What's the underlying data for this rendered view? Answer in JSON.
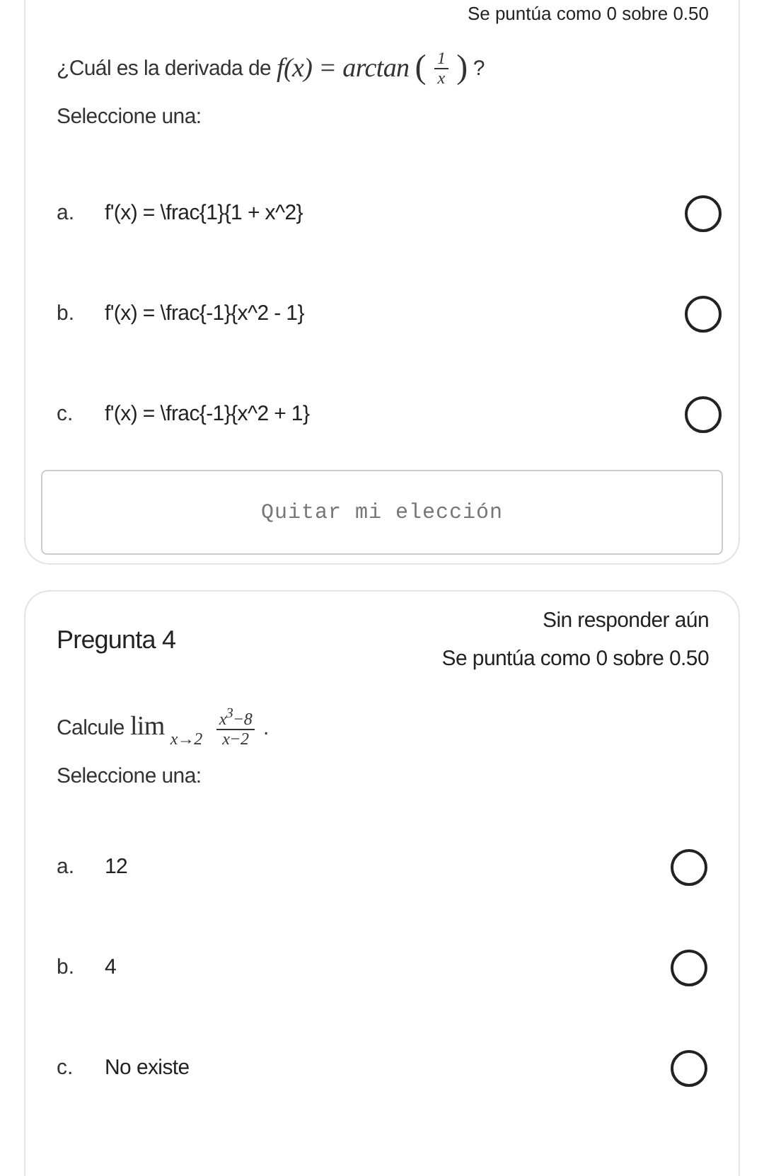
{
  "previous_question": {
    "grade_text": "Se puntúa como 0 sobre 0.50",
    "prompt": {
      "before": "¿Cuál es la derivada de",
      "math_left": "f(x) = arctan",
      "open_paren": "(",
      "close_paren": ")",
      "numerator": "1",
      "denominator": "x",
      "after": "?"
    },
    "instruction": "Seleccione una:",
    "options": [
      {
        "letter": "a.",
        "text": "f'(x) = \\frac{1}{1 + x^2}",
        "selected": false
      },
      {
        "letter": "b.",
        "text": "f'(x) = \\frac{-1}{x^2 - 1}",
        "selected": false
      },
      {
        "letter": "c.",
        "text": "f'(x) = \\frac{-1}{x^2 + 1}",
        "selected": false
      }
    ],
    "clear_button": "Quitar mi elección"
  },
  "question": {
    "title": "Pregunta 4",
    "status": "Sin responder aún",
    "grade_text": "Se puntúa como 0 sobre 0.50",
    "prompt": {
      "before": "Calcule",
      "operator": "lim",
      "subscript": "x→2",
      "numerator": "x$^{3}$−8",
      "denominator": "x−2",
      "after": "."
    },
    "instruction": "Seleccione una:",
    "options": [
      {
        "letter": "a.",
        "text": "12",
        "selected": false
      },
      {
        "letter": "b.",
        "text": "4",
        "selected": false
      },
      {
        "letter": "c.",
        "text": "No existe",
        "selected": false
      }
    ]
  }
}
